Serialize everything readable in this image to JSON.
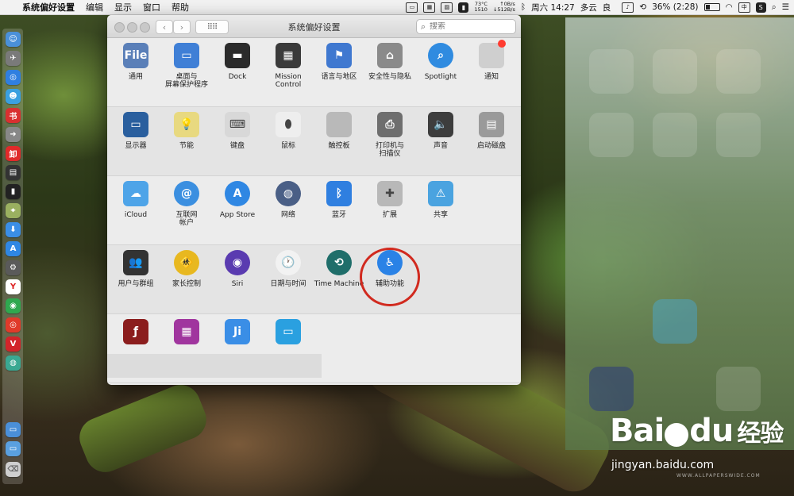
{
  "menubar": {
    "apple_icon": "",
    "app_name": "系统偏好设置",
    "menus": [
      "编辑",
      "显示",
      "窗口",
      "帮助"
    ],
    "status": {
      "temp": "73°C",
      "rpm": "1510",
      "net_up": "↑0B/s",
      "net_down": "↓512B/s",
      "datetime": "周六 14:27",
      "weather": "多云",
      "weather_quality": "良",
      "battery": "36% (2:28)",
      "battery_level": 0.36,
      "input_method": "中"
    }
  },
  "window": {
    "title": "系统偏好设置",
    "back": "‹",
    "forward": "›",
    "grid_glyph": "⠿⠿",
    "search_placeholder": "搜索"
  },
  "rows": [
    {
      "items": [
        {
          "name": "general",
          "label": "通用",
          "color": "#5a7fb8",
          "glyph": "File"
        },
        {
          "name": "desktop-screensaver",
          "label": "桌面与\n屏幕保护程序",
          "color": "#3f7fd6",
          "glyph": "▭"
        },
        {
          "name": "dock",
          "label": "Dock",
          "color": "#2b2b2b",
          "glyph": "▬"
        },
        {
          "name": "mission-control",
          "label": "Mission\nControl",
          "color": "#3a3a3a",
          "glyph": "▦"
        },
        {
          "name": "language-region",
          "label": "语言与地区",
          "color": "#3f78d0",
          "glyph": "⚑"
        },
        {
          "name": "security-privacy",
          "label": "安全性与隐私",
          "color": "#8a8a8a",
          "glyph": "⌂"
        },
        {
          "name": "spotlight",
          "label": "Spotlight",
          "color": "#2f8be0",
          "glyph": "⌕"
        },
        {
          "name": "notifications",
          "label": "通知",
          "color": "#cfcfcf",
          "glyph": ""
        }
      ]
    },
    {
      "items": [
        {
          "name": "displays",
          "label": "显示器",
          "color": "#2a5f9e",
          "glyph": "▭"
        },
        {
          "name": "energy-saver",
          "label": "节能",
          "color": "#e8d980",
          "glyph": "💡"
        },
        {
          "name": "keyboard",
          "label": "键盘",
          "color": "#d8d8d8",
          "glyph": "⌨"
        },
        {
          "name": "mouse",
          "label": "鼠标",
          "color": "#eeeeee",
          "glyph": "⬮"
        },
        {
          "name": "trackpad",
          "label": "触控板",
          "color": "#b9b9b9",
          "glyph": ""
        },
        {
          "name": "printers-scanners",
          "label": "打印机与\n扫描仪",
          "color": "#6e6e6e",
          "glyph": "⎙"
        },
        {
          "name": "sound",
          "label": "声音",
          "color": "#3d3d3d",
          "glyph": "🔈"
        },
        {
          "name": "startup-disk",
          "label": "启动磁盘",
          "color": "#9a9a9a",
          "glyph": "▤"
        }
      ]
    },
    {
      "items": [
        {
          "name": "icloud",
          "label": "iCloud",
          "color": "#4ea4e8",
          "glyph": "☁"
        },
        {
          "name": "internet-accounts",
          "label": "互联网\n帐户",
          "color": "#3b8fe0",
          "glyph": "@"
        },
        {
          "name": "app-store",
          "label": "App Store",
          "color": "#2f87e3",
          "glyph": "A"
        },
        {
          "name": "network",
          "label": "网络",
          "color": "#4a5f86",
          "glyph": "◍"
        },
        {
          "name": "bluetooth",
          "label": "蓝牙",
          "color": "#2f7fe0",
          "glyph": "ᛒ"
        },
        {
          "name": "extensions",
          "label": "扩展",
          "color": "#b8b8b8",
          "glyph": "✚"
        },
        {
          "name": "sharing",
          "label": "共享",
          "color": "#4aa3e0",
          "glyph": "⚠"
        }
      ]
    },
    {
      "items": [
        {
          "name": "users-groups",
          "label": "用户与群组",
          "color": "#333333",
          "glyph": "👥"
        },
        {
          "name": "parental-controls",
          "label": "家长控制",
          "color": "#e8b820",
          "glyph": "🚸"
        },
        {
          "name": "siri",
          "label": "Siri",
          "color": "#5a3bb0",
          "glyph": "◉"
        },
        {
          "name": "date-time",
          "label": "日期与时间",
          "color": "#f2f2f2",
          "glyph": "🕐"
        },
        {
          "name": "time-machine",
          "label": "Time Machine",
          "color": "#1f6e6a",
          "glyph": "⟲"
        },
        {
          "name": "accessibility",
          "label": "辅助功能",
          "color": "#2a82e6",
          "glyph": "♿"
        }
      ]
    },
    {
      "items": [
        {
          "name": "flash-player",
          "label": "",
          "color": "#8b1d1d",
          "glyph": "ƒ"
        },
        {
          "name": "third-party-1",
          "label": "",
          "color": "#a0359e",
          "glyph": "▦"
        },
        {
          "name": "third-party-ji",
          "label": "",
          "color": "#3a8ee6",
          "glyph": "Ji"
        },
        {
          "name": "third-party-display",
          "label": "",
          "color": "#2aa0e0",
          "glyph": "▭"
        }
      ]
    }
  ],
  "watermark": {
    "logo_text": "Bai",
    "logo_text2": "du",
    "logo_cn": "经验",
    "url": "jingyan.baidu.com",
    "caption": "WWW.ALLPAPERSWIDE.COM"
  },
  "accent_colors": {
    "highlight_ring": "#d12a1f"
  }
}
